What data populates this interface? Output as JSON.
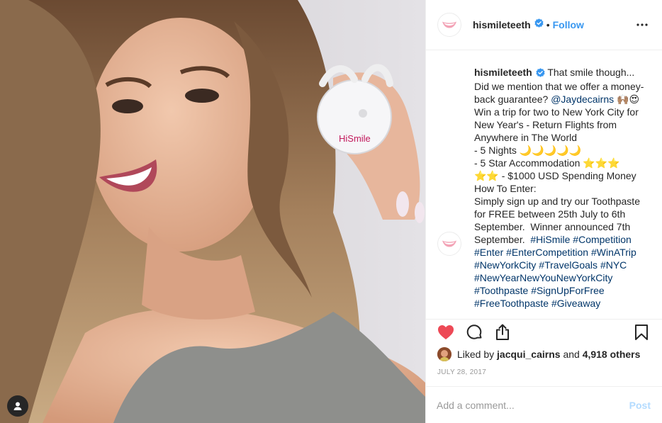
{
  "post": {
    "username": "hismileteeth",
    "separator": "•",
    "follow_label": "Follow",
    "verified": true,
    "caption_lines": [
      [
        {
          "t": "That smile though..."
        }
      ],
      [
        {
          "t": "Did we mention that we offer a money-"
        }
      ],
      [
        {
          "t": "back guarantee? "
        },
        {
          "t": "@Jaydecairns",
          "link": true
        },
        {
          "t": " 🙌🏽😍"
        }
      ],
      [
        {
          "t": "Win a trip for two to New York City for"
        }
      ],
      [
        {
          "t": "New Year's - Return Flights from"
        }
      ],
      [
        {
          "t": "Anywhere in The World"
        }
      ],
      [
        {
          "t": "- 5 Nights 🌙🌙🌙🌙🌙"
        }
      ],
      [
        {
          "t": "- 5 Star Accommodation ⭐⭐⭐"
        }
      ],
      [
        {
          "t": "⭐⭐ - $1000 USD Spending Money"
        }
      ],
      [
        {
          "t": "How To Enter:"
        }
      ],
      [
        {
          "t": "Simply sign up and try our Toothpaste"
        }
      ],
      [
        {
          "t": "for FREE between 25th July to 6th"
        }
      ],
      [
        {
          "t": "September.  Winner announced 7th"
        }
      ],
      [
        {
          "t": "September.  "
        },
        {
          "t": "#HiSmile",
          "link": true
        },
        {
          "t": " "
        },
        {
          "t": "#Competition",
          "link": true
        }
      ],
      [
        {
          "t": "#Enter",
          "link": true
        },
        {
          "t": " "
        },
        {
          "t": "#EnterCompetition",
          "link": true
        },
        {
          "t": " "
        },
        {
          "t": "#WinATrip",
          "link": true
        }
      ],
      [
        {
          "t": "#NewYorkCity",
          "link": true
        },
        {
          "t": " "
        },
        {
          "t": "#TravelGoals",
          "link": true
        },
        {
          "t": " "
        },
        {
          "t": "#NYC",
          "link": true
        }
      ],
      [
        {
          "t": "#NewYearNewYouNewYorkCity",
          "link": true
        }
      ],
      [
        {
          "t": "#Toothpaste",
          "link": true
        },
        {
          "t": " "
        },
        {
          "t": "#SignUpForFree",
          "link": true
        }
      ],
      [
        {
          "t": "#FreeToothpaste",
          "link": true
        },
        {
          "t": " "
        },
        {
          "t": "#Giveaway",
          "link": true
        }
      ]
    ],
    "photo_product_text": "HiSmile"
  },
  "likes": {
    "prefix": "Liked by ",
    "liker": "jacqui_cairns",
    "middle": " and ",
    "others": "4,918 others"
  },
  "date": "JULY 28, 2017",
  "comment_box": {
    "placeholder": "Add a comment...",
    "post_label": "Post"
  },
  "colors": {
    "accent": "#3897f0",
    "heart": "#ed4956",
    "hashtag": "#003569",
    "post_disabled": "#b3dbff"
  },
  "icons": {
    "like": "heart-filled-icon",
    "comment": "speech-bubble-icon",
    "share": "share-upload-icon",
    "save": "bookmark-icon",
    "more": "more-horizontal-icon",
    "tags": "user-tag-icon"
  }
}
